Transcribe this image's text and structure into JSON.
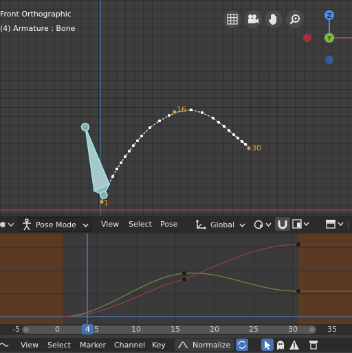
{
  "viewport": {
    "view_name": "Front Orthographic",
    "object_info": "(4) Armature : Bone",
    "frame_labels": {
      "start": "1",
      "mid": "16",
      "end": "30"
    },
    "nav_icons": [
      "grid-icon",
      "camera-icon",
      "hand-icon",
      "zoom-icon"
    ],
    "gizmo": {
      "z": "Z",
      "y": "Y"
    }
  },
  "header3d": {
    "mode": "Pose Mode",
    "menu": [
      "View",
      "Select",
      "Pose"
    ],
    "orientation": "Global"
  },
  "graph": {
    "frame_ticks": [
      "-5",
      "0",
      "5",
      "10",
      "15",
      "20",
      "25",
      "30",
      "35"
    ],
    "current_frame": "4"
  },
  "header2": {
    "menu": [
      "View",
      "Select",
      "Marker",
      "Channel",
      "Key"
    ],
    "normalize": "Normalize"
  },
  "colors": {
    "accent": "#4772b3",
    "bone": "#8fd8dc",
    "path_orange": "#f0a030",
    "range": "#5a3a22"
  }
}
